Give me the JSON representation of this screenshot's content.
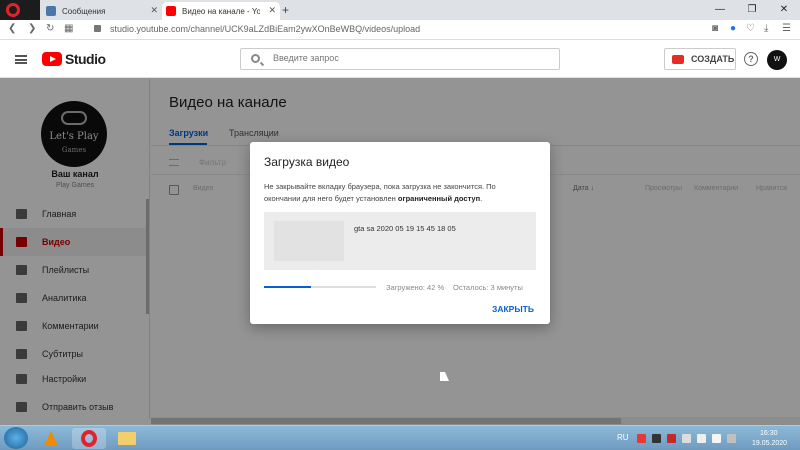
{
  "browser": {
    "tabs": [
      {
        "label": "Сообщения"
      },
      {
        "label": "Видео на канале - YouTube"
      }
    ],
    "new_tab": "+",
    "url": "studio.youtube.com/channel/UCK9aLZdBiEam2ywXOnBeWBQ/videos/upload",
    "window_controls": [
      "—",
      "❐",
      "✕"
    ]
  },
  "header": {
    "logo_text": "Studio",
    "search_placeholder": "Введите запрос",
    "create_label": "СОЗДАТЬ",
    "help": "?"
  },
  "sidebar": {
    "avatar_line1": "Let's Play",
    "avatar_line2": "Games",
    "channel_label": "Ваш канал",
    "channel_name": "Play Games",
    "items": [
      {
        "label": "Главная",
        "icon": "dashboard-icon"
      },
      {
        "label": "Видео",
        "icon": "video-icon",
        "active": true
      },
      {
        "label": "Плейлисты",
        "icon": "playlist-icon"
      },
      {
        "label": "Аналитика",
        "icon": "analytics-icon"
      },
      {
        "label": "Комментарии",
        "icon": "comments-icon"
      },
      {
        "label": "Субтитры",
        "icon": "subtitles-icon"
      },
      {
        "label": "Настройки",
        "icon": "gear-icon"
      },
      {
        "label": "Отправить отзыв",
        "icon": "feedback-icon"
      }
    ]
  },
  "main": {
    "title": "Видео на канале",
    "tabs": [
      "Загрузки",
      "Трансляции"
    ],
    "filter_placeholder": "Фильтр",
    "columns": [
      "Видео",
      "Дата ↓",
      "Просмотры",
      "Комментарии",
      "Нравится"
    ]
  },
  "dialog": {
    "title": "Загрузка видео",
    "message": "Не закрывайте вкладку браузера, пока загрузка не закончится. По окончании для него будет установлен",
    "message_bold": "ограниченный доступ",
    "file_name": "gta sa 2020 05 19 15 45 18 05",
    "progress_percent": 42,
    "progress_text": "Загружено: 42 %",
    "time_left": "Осталось: 3 минуты",
    "close_label": "ЗАКРЫТЬ"
  },
  "taskbar": {
    "language": "RU",
    "time": "16:30",
    "date": "19.05.2020"
  },
  "colors": {
    "accent_blue": "#065fd4",
    "youtube_red": "#ff0000"
  }
}
